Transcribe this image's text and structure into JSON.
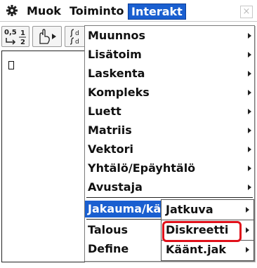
{
  "menubar": {
    "items": [
      "Muok",
      "Toiminto",
      "Interakt"
    ],
    "close_label": "×"
  },
  "toolbar": {
    "fraction_top": "0,5",
    "fraction_num": "1",
    "fraction_den": "2"
  },
  "menu": {
    "items": [
      {
        "label": "Muunnos"
      },
      {
        "label": "Lisätoim"
      },
      {
        "label": "Laskenta"
      },
      {
        "label": "Kompleks"
      },
      {
        "label": "Luett"
      },
      {
        "label": "Matriis"
      },
      {
        "label": "Vektori"
      },
      {
        "label": "Yhtälö/Epäyhtälö"
      },
      {
        "label": "Avustaja"
      },
      {
        "label": "Jakauma/kään"
      },
      {
        "label": "Talous"
      },
      {
        "label": "Define"
      }
    ]
  },
  "submenu": {
    "items": [
      {
        "label": "Jatkuva"
      },
      {
        "label": "Diskreetti"
      },
      {
        "label": "Käänt.jak"
      }
    ]
  },
  "colors": {
    "accent": "#1a5fd0",
    "highlight": "#e0101a"
  }
}
